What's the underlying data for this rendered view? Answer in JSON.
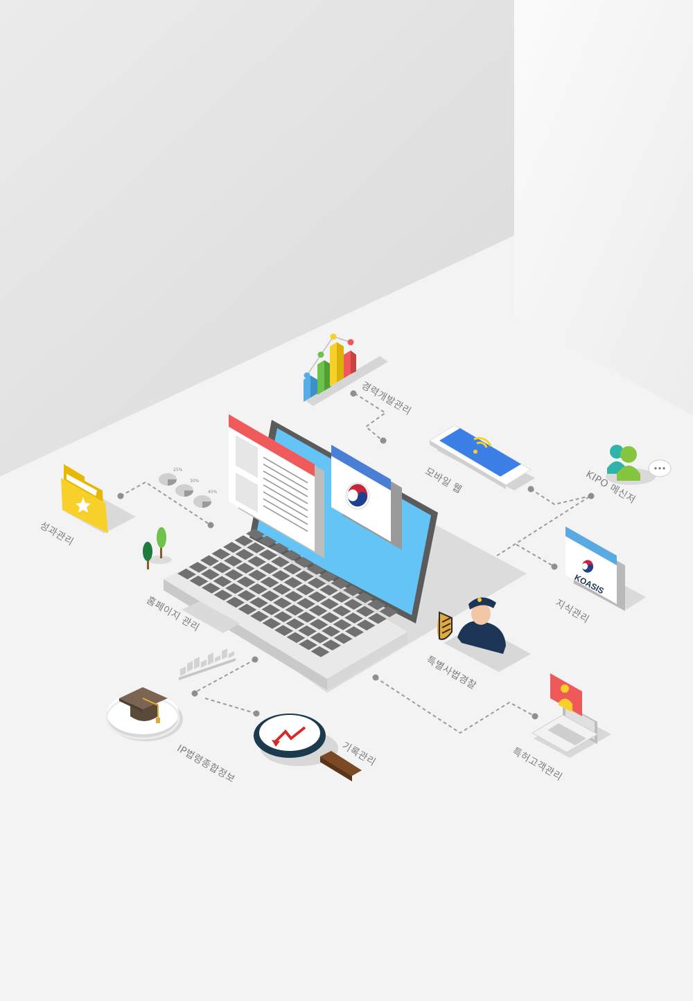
{
  "labels": {
    "career": "경력개발관리",
    "mobile": "모바일 웹",
    "messenger": "KIPO 메신저",
    "knowledge": "지식관리",
    "performance": "성과관리",
    "homepage": "홈페이지 관리",
    "police": "특별사법경찰",
    "ip_info": "IP법령종합정보",
    "records": "기록관리",
    "customer": "특허고객관리"
  },
  "koasis_text": "KOASIS",
  "pie_labels": [
    "25%",
    "30%",
    "45%"
  ],
  "colors": {
    "background_wall": "#e2e2e2",
    "floor": "#f3f3f3",
    "screen_blue": "#64c4f6",
    "accent_red": "#f0595a",
    "accent_blue": "#4a86df",
    "accent_yellow": "#f7d12a",
    "accent_green": "#6cc24a",
    "navy": "#1c3556"
  }
}
